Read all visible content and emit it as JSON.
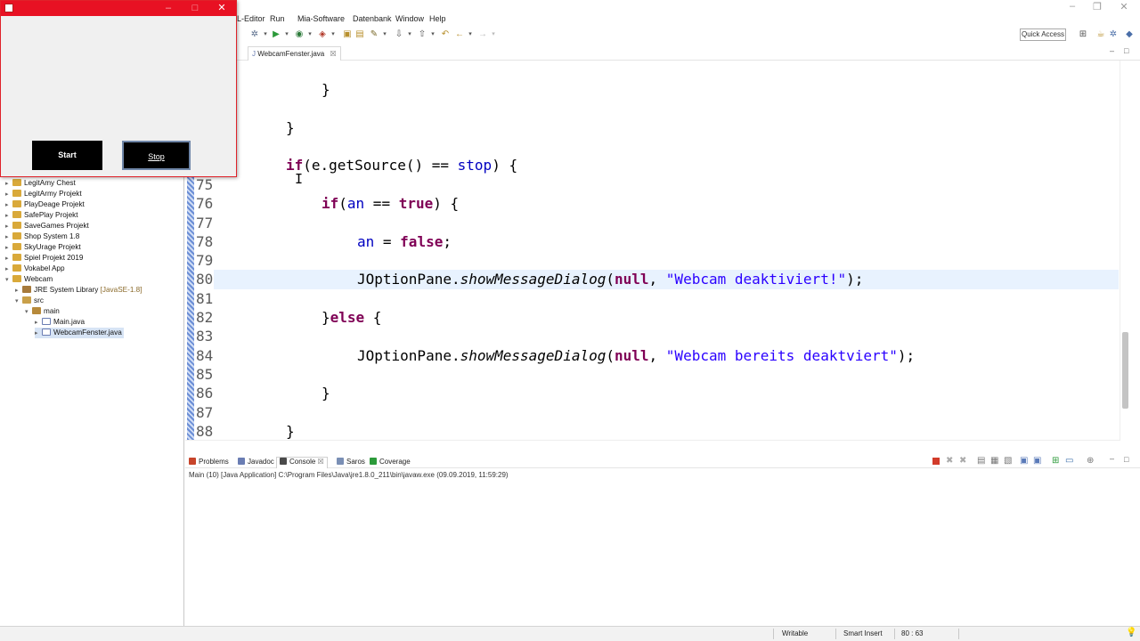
{
  "menu": [
    "L-Editor",
    "Run",
    "Mia-Software",
    "Datenbank",
    "Window",
    "Help"
  ],
  "toolbar": {
    "quick_access": "Quick Access"
  },
  "editor_tab": {
    "label": "WebcamFenster.java",
    "close": "☒"
  },
  "explorer": {
    "items": [
      {
        "label": "LegitAmy Chest",
        "icon": "project-icon",
        "depth": 0,
        "arrow": "▸"
      },
      {
        "label": "LegitArmy Projekt",
        "icon": "project-icon",
        "depth": 0,
        "arrow": "▸"
      },
      {
        "label": "PlayDeage Projekt",
        "icon": "project-icon",
        "depth": 0,
        "arrow": "▸"
      },
      {
        "label": "SafePlay Projekt",
        "icon": "project-icon",
        "depth": 0,
        "arrow": "▸"
      },
      {
        "label": "SaveGames Projekt",
        "icon": "project-icon",
        "depth": 0,
        "arrow": "▸"
      },
      {
        "label": "Shop System 1.8",
        "icon": "project-icon",
        "depth": 0,
        "arrow": "▸"
      },
      {
        "label": "SkyUrage Projekt",
        "icon": "project-icon",
        "depth": 0,
        "arrow": "▸"
      },
      {
        "label": "Spiel Projekt 2019",
        "icon": "project-icon",
        "depth": 0,
        "arrow": "▸"
      },
      {
        "label": "Vokabel App",
        "icon": "project-icon",
        "depth": 0,
        "arrow": "▸"
      },
      {
        "label": "Webcam",
        "icon": "project-icon",
        "depth": 0,
        "arrow": "▾"
      },
      {
        "label": "JRE System Library",
        "suffix": "[JavaSE-1.8]",
        "icon": "library-icon",
        "depth": 1,
        "arrow": "▸"
      },
      {
        "label": "src",
        "icon": "source-folder-icon",
        "depth": 1,
        "arrow": "▾"
      },
      {
        "label": "main",
        "icon": "package-icon",
        "depth": 2,
        "arrow": "▾"
      },
      {
        "label": "Main.java",
        "icon": "java-file-icon",
        "depth": 3,
        "arrow": "▸"
      },
      {
        "label": "WebcamFenster.java",
        "icon": "java-file-icon",
        "depth": 3,
        "arrow": "▸",
        "selected": true
      }
    ]
  },
  "code": {
    "line_numbers": [
      "75",
      "76",
      "77",
      "78",
      "79",
      "80",
      "81",
      "82",
      "83",
      "84",
      "85",
      "86",
      "87",
      "88"
    ],
    "current_line": "80"
  },
  "console": {
    "tabs": [
      "Problems",
      "Javadoc",
      "Console",
      "Saros",
      "Coverage"
    ],
    "active_tab": "Console",
    "status": "Main (10) [Java Application] C:\\Program Files\\Java\\jre1.8.0_211\\bin\\javaw.exe (09.09.2019, 11:59:29)"
  },
  "statusbar": {
    "writable": "Writable",
    "insert_mode": "Smart Insert",
    "position": "80 : 63"
  },
  "swing_window": {
    "start_label": "Start",
    "stop_label": "Stop"
  },
  "colors": {
    "swing_title": "#e81123",
    "keyword": "#7f0055",
    "string": "#2a00ff",
    "current_line": "#e8f2fe"
  }
}
